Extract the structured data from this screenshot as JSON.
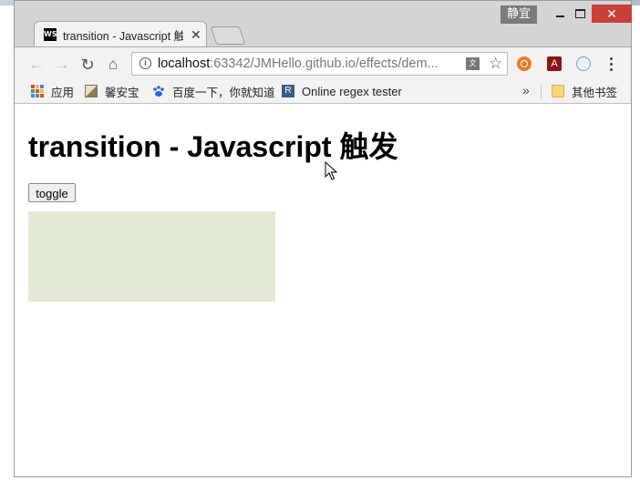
{
  "window": {
    "profile_badge": "静宜",
    "controls": {
      "minimize": "minimize",
      "maximize": "maximize",
      "close": "✕"
    }
  },
  "tab": {
    "favicon": "WS",
    "title": "transition - Javascript 触",
    "close": "✕"
  },
  "toolbar": {
    "back": "←",
    "forward": "→",
    "reload": "↻",
    "home": "⌂",
    "url_host": "localhost",
    "url_rest": ":63342/JMHello.github.io/effects/dem...",
    "translate": "文",
    "star": "☆",
    "ext_pdf": "A"
  },
  "bookmarks": {
    "apps": "应用",
    "item2": "馨安宝",
    "item3": "百度一下，你就知道",
    "item4_icon": "R",
    "item4": "Online regex tester",
    "overflow": "»",
    "other": "其他书签"
  },
  "page": {
    "heading": "transition - Javascript 触发",
    "toggle_label": "toggle",
    "box_color": "#e1e8d3"
  },
  "colors": {
    "close_button": "#c9403a",
    "profile_badge": "#7b7b7b"
  }
}
